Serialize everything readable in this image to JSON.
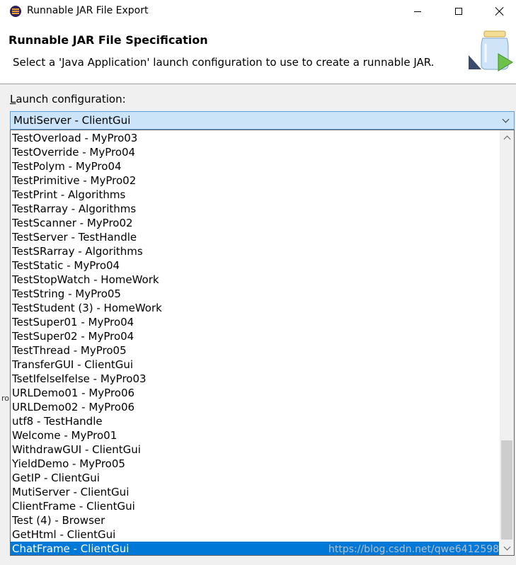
{
  "window": {
    "title": "Runnable JAR File Export",
    "icon": "eclipse-icon"
  },
  "header": {
    "title": "Runnable JAR File Specification",
    "description": "Select a 'Java Application' launch configuration to use to create a runnable JAR.",
    "image": "jar-export-wizard-icon"
  },
  "launch": {
    "label_mnemonic": "L",
    "label_rest": "aunch configuration:",
    "selected_value": "MutiServer - ClientGui"
  },
  "dropdown": {
    "items": [
      "TestOverload - MyPro03",
      "TestOverride - MyPro04",
      "TestPolym - MyPro04",
      "TestPrimitive - MyPro02",
      "TestPrint - Algorithms",
      "TestRarray - Algorithms",
      "TestScanner - MyPro02",
      "TestServer - TestHandle",
      "TestSRarray - Algorithms",
      "TestStatic - MyPro04",
      "TestStopWatch - HomeWork",
      "TestString - MyPro05",
      "TestStudent (3) - HomeWork",
      "TestSuper01 - MyPro04",
      "TestSuper02 - MyPro04",
      "TestThread - MyPro05",
      "TransferGUI - ClientGui",
      "TsetIfelseIfelse - MyPro03",
      "URLDemo01 - MyPro06",
      "URLDemo02 - MyPro06",
      "utf8 - TestHandle",
      "Welcome - MyPro01",
      "WithdrawGUI - ClientGui",
      "YieldDemo - MyPro05",
      "GetIP - ClientGui",
      "MutiServer - ClientGui",
      "ClientFrame - ClientGui",
      "Test (4) - Browser",
      "GetHtml - ClientGui",
      "ChatFrame - ClientGui"
    ],
    "highlighted": "ChatFrame - ClientGui"
  },
  "background_fragment": "ro",
  "watermark": "https://blog.csdn.net/qwe6412598"
}
